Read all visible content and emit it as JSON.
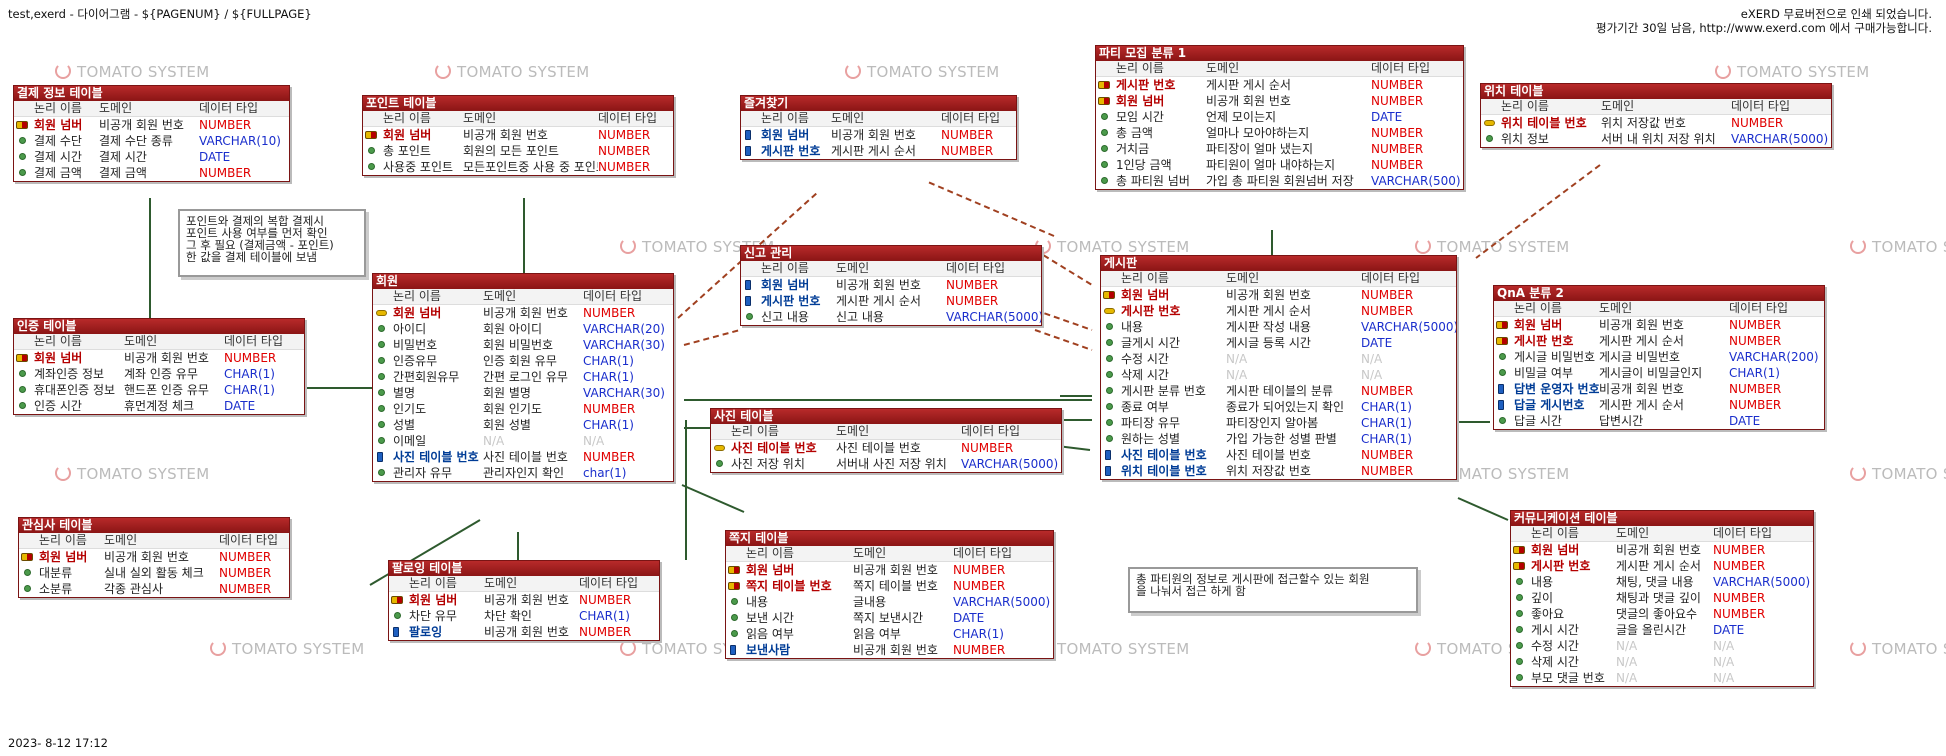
{
  "header": {
    "left": "test,exerd - 다이어그램 - ${PAGENUM} / ${FULLPAGE}",
    "right_line1": "eXERD 무료버전으로 인쇄 되었습니다.",
    "right_line2": "평가기간 30일 남음, http://www.exerd.com 에서 구매가능합니다."
  },
  "footer": {
    "date": "2023- 8-12 17:12"
  },
  "watermark": "TOMATO SYSTEM",
  "watermark_clipped": "TOMATO SYSTE",
  "colors": {
    "title_bg": "#9a1a1a",
    "number_type": "#e00000",
    "text_type": "#1a2ecc",
    "na": "#c8c8c8",
    "relation_line_green": "#2e5a2e",
    "relation_line_brown": "#a04020"
  },
  "col_headers": {
    "logical": "논리 이름",
    "domain": "도메인",
    "datatype": "데이터 타입"
  },
  "notes": [
    "포인트와 결제의 복합 결제시\n포인트 사용 여부를 먼저 확인\n그 후 필요 (결제금액 - 포인트)\n한 값을 결제 테이블에 보냄",
    "총 파티원의 정보로 게시판에 접근할수 있는 회원\n을 나눠서 접근 하게 함"
  ],
  "tables": [
    {
      "name": "결제 정보 테이블",
      "rows": [
        {
          "n": "회원 넘버",
          "d": "비공개 회원 번호",
          "t": "NUMBER",
          "k": "pkfk"
        },
        {
          "n": "결제 수단",
          "d": "결제 수단 종류",
          "t": "VARCHAR(10)",
          "k": ""
        },
        {
          "n": "결제 시간",
          "d": "결제 시간",
          "t": "DATE",
          "k": ""
        },
        {
          "n": "결제 금액",
          "d": "결제 금액",
          "t": "NUMBER",
          "k": ""
        }
      ]
    },
    {
      "name": "포인트 테이블",
      "rows": [
        {
          "n": "회원 넘버",
          "d": "비공개 회원 번호",
          "t": "NUMBER",
          "k": "pkfk"
        },
        {
          "n": "총 포인트",
          "d": "회원의 모든 포인트",
          "t": "NUMBER",
          "k": ""
        },
        {
          "n": "사용중 포인트",
          "d": "모든포인트중 사용 중 포인트",
          "t": "NUMBER",
          "k": ""
        }
      ]
    },
    {
      "name": "즐겨찾기",
      "rows": [
        {
          "n": "회원 넘버",
          "d": "비공개 회원 번호",
          "t": "NUMBER",
          "k": "fk"
        },
        {
          "n": "게시판 번호",
          "d": "게시판 게시 순서",
          "t": "NUMBER",
          "k": "fk"
        }
      ]
    },
    {
      "name": "파티 모집 분류 1",
      "rows": [
        {
          "n": "게시판 번호",
          "d": "게시판 게시 순서",
          "t": "NUMBER",
          "k": "pkfk"
        },
        {
          "n": "회원 넘버",
          "d": "비공개 회원 번호",
          "t": "NUMBER",
          "k": "pkfk"
        },
        {
          "n": "모임 시간",
          "d": "언제 모이는지",
          "t": "DATE",
          "k": ""
        },
        {
          "n": "총 금액",
          "d": "얼마나 모아야하는지",
          "t": "NUMBER",
          "k": ""
        },
        {
          "n": "거치금",
          "d": "파티장이 얼마 냈는지",
          "t": "NUMBER",
          "k": ""
        },
        {
          "n": "1인당 금액",
          "d": "파티원이 얼마 내야하는지",
          "t": "NUMBER",
          "k": ""
        },
        {
          "n": "총 파티원 넘버",
          "d": "가입 총 파티원 회원넘버 저장",
          "t": "VARCHAR(500)",
          "k": ""
        }
      ]
    },
    {
      "name": "위치 테이블",
      "rows": [
        {
          "n": "위치 테이블 번호",
          "d": "위치 저장값 번호",
          "t": "NUMBER",
          "k": "pk"
        },
        {
          "n": "위치 정보",
          "d": "서버 내 위치 저장 위치",
          "t": "VARCHAR(5000)",
          "k": ""
        }
      ]
    },
    {
      "name": "인증 테이블",
      "rows": [
        {
          "n": "회원 넘버",
          "d": "비공개 회원 번호",
          "t": "NUMBER",
          "k": "pkfk"
        },
        {
          "n": "계좌인증 정보",
          "d": "계좌 인증 유무",
          "t": "CHAR(1)",
          "k": ""
        },
        {
          "n": "휴대폰인증 정보",
          "d": "핸드폰 인증 유무",
          "t": "CHAR(1)",
          "k": ""
        },
        {
          "n": "인증 시간",
          "d": "휴먼계정 체크",
          "t": "DATE",
          "k": ""
        }
      ]
    },
    {
      "name": "회원",
      "rows": [
        {
          "n": "회원 넘버",
          "d": "비공개 회원 번호",
          "t": "NUMBER",
          "k": "pk"
        },
        {
          "n": "아이디",
          "d": "회원 아이디",
          "t": "VARCHAR(20)",
          "k": ""
        },
        {
          "n": "비밀번호",
          "d": "회원 비밀번호",
          "t": "VARCHAR(30)",
          "k": ""
        },
        {
          "n": "인증유무",
          "d": "인증 회원 유무",
          "t": "CHAR(1)",
          "k": ""
        },
        {
          "n": "간편회원유무",
          "d": "간편 로그인 유무",
          "t": "CHAR(1)",
          "k": ""
        },
        {
          "n": "별명",
          "d": "회원 별명",
          "t": "VARCHAR(30)",
          "k": ""
        },
        {
          "n": "인기도",
          "d": "회원 인기도",
          "t": "NUMBER",
          "k": ""
        },
        {
          "n": "성별",
          "d": "회원 성별",
          "t": "CHAR(1)",
          "k": ""
        },
        {
          "n": "이메일",
          "d": "N/A",
          "t": "N/A",
          "k": ""
        },
        {
          "n": "사진 테이블 번호",
          "d": "사진 테이블 번호",
          "t": "NUMBER",
          "k": "fk"
        },
        {
          "n": "관리자 유무",
          "d": "관리자인지 확인",
          "t": "char(1)",
          "k": ""
        }
      ]
    },
    {
      "name": "신고 관리",
      "rows": [
        {
          "n": "회원 넘버",
          "d": "비공개 회원 번호",
          "t": "NUMBER",
          "k": "fk"
        },
        {
          "n": "게시판 번호",
          "d": "게시판 게시 순서",
          "t": "NUMBER",
          "k": "fk"
        },
        {
          "n": "신고 내용",
          "d": "신고 내용",
          "t": "VARCHAR(5000)",
          "k": ""
        }
      ]
    },
    {
      "name": "게시판",
      "rows": [
        {
          "n": "회원 넘버",
          "d": "비공개 회원 번호",
          "t": "NUMBER",
          "k": "pkfk"
        },
        {
          "n": "게시판 번호",
          "d": "게시판 게시 순서",
          "t": "NUMBER",
          "k": "pk"
        },
        {
          "n": "내용",
          "d": "게시판 작성 내용",
          "t": "VARCHAR(5000)",
          "k": ""
        },
        {
          "n": "글게시 시간",
          "d": "게시글 등록 시간",
          "t": "DATE",
          "k": ""
        },
        {
          "n": "수정 시간",
          "d": "N/A",
          "t": "N/A",
          "k": ""
        },
        {
          "n": "삭제 시간",
          "d": "N/A",
          "t": "N/A",
          "k": ""
        },
        {
          "n": "게시판 분류 번호",
          "d": "게시판 테이블의 분류",
          "t": "NUMBER",
          "k": ""
        },
        {
          "n": "종료 여부",
          "d": "종료가 되어있는지 확인",
          "t": "CHAR(1)",
          "k": ""
        },
        {
          "n": "파티장 유무",
          "d": "파티장인지 알아봄",
          "t": "CHAR(1)",
          "k": ""
        },
        {
          "n": "원하는 성별",
          "d": "가입 가능한 성별 판별",
          "t": "CHAR(1)",
          "k": ""
        },
        {
          "n": "사진 테이블 번호",
          "d": "사진 테이블 번호",
          "t": "NUMBER",
          "k": "fk"
        },
        {
          "n": "위치 테이블 번호",
          "d": "위치 저장값 번호",
          "t": "NUMBER",
          "k": "fk"
        }
      ]
    },
    {
      "name": "QnA 분류 2",
      "rows": [
        {
          "n": "회원 넘버",
          "d": "비공개 회원 번호",
          "t": "NUMBER",
          "k": "pkfk"
        },
        {
          "n": "게시판 번호",
          "d": "게시판 게시 순서",
          "t": "NUMBER",
          "k": "pkfk"
        },
        {
          "n": "게시글 비밀번호",
          "d": "게시글 비밀번호",
          "t": "VARCHAR(200)",
          "k": ""
        },
        {
          "n": "비밀글 여부",
          "d": "게시글이 비밀글인지",
          "t": "CHAR(1)",
          "k": ""
        },
        {
          "n": "답변 운영자 번호",
          "d": "비공개 회원 번호",
          "t": "NUMBER",
          "k": "fk"
        },
        {
          "n": "답글 게시번호",
          "d": "게시판 게시 순서",
          "t": "NUMBER",
          "k": "fk"
        },
        {
          "n": "답글 시간",
          "d": "답변시간",
          "t": "DATE",
          "k": ""
        }
      ]
    },
    {
      "name": "사진 테이블",
      "rows": [
        {
          "n": "사진 테이블 번호",
          "d": "사진 테이블 번호",
          "t": "NUMBER",
          "k": "pk"
        },
        {
          "n": "사진 저장 위치",
          "d": "서버내 사진 저장 위치",
          "t": "VARCHAR(5000)",
          "k": ""
        }
      ]
    },
    {
      "name": "관심사 테이블",
      "rows": [
        {
          "n": "회원 넘버",
          "d": "비공개 회원 번호",
          "t": "NUMBER",
          "k": "pkfk"
        },
        {
          "n": "대분류",
          "d": "실내 실외 활동 체크",
          "t": "NUMBER",
          "k": ""
        },
        {
          "n": "소분류",
          "d": "각종 관심사",
          "t": "NUMBER",
          "k": ""
        }
      ]
    },
    {
      "name": "팔로잉 테이블",
      "rows": [
        {
          "n": "회원 넘버",
          "d": "비공개 회원 번호",
          "t": "NUMBER",
          "k": "pkfk"
        },
        {
          "n": "차단 유무",
          "d": "차단 확인",
          "t": "CHAR(1)",
          "k": ""
        },
        {
          "n": "팔로잉",
          "d": "비공개 회원 번호",
          "t": "NUMBER",
          "k": "fk"
        }
      ]
    },
    {
      "name": "쪽지 테이블",
      "rows": [
        {
          "n": "회원 넘버",
          "d": "비공개 회원 번호",
          "t": "NUMBER",
          "k": "pkfk"
        },
        {
          "n": "쪽지 테이블 번호",
          "d": "쪽지 테이블 번호",
          "t": "NUMBER",
          "k": "pkfk"
        },
        {
          "n": "내용",
          "d": "글내용",
          "t": "VARCHAR(5000)",
          "k": ""
        },
        {
          "n": "보낸 시간",
          "d": "쪽지 보낸시간",
          "t": "DATE",
          "k": ""
        },
        {
          "n": "읽음 여부",
          "d": "읽음 여부",
          "t": "CHAR(1)",
          "k": ""
        },
        {
          "n": "보낸사람",
          "d": "비공개 회원 번호",
          "t": "NUMBER",
          "k": "fk"
        }
      ]
    },
    {
      "name": "커뮤니케이션 테이블",
      "rows": [
        {
          "n": "회원 넘버",
          "d": "비공개 회원 번호",
          "t": "NUMBER",
          "k": "pkfk"
        },
        {
          "n": "게시판 번호",
          "d": "게시판 게시 순서",
          "t": "NUMBER",
          "k": "pkfk"
        },
        {
          "n": "내용",
          "d": "채팅, 댓글 내용",
          "t": "VARCHAR(5000)",
          "k": ""
        },
        {
          "n": "깊이",
          "d": "채팅과 댓글 깊이",
          "t": "NUMBER",
          "k": ""
        },
        {
          "n": "좋아요",
          "d": "댓글의 좋아요수",
          "t": "NUMBER",
          "k": ""
        },
        {
          "n": "게시 시간",
          "d": "글을 올린시간",
          "t": "DATE",
          "k": ""
        },
        {
          "n": "수정 시간",
          "d": "N/A",
          "t": "N/A",
          "k": ""
        },
        {
          "n": "삭제 시간",
          "d": "N/A",
          "t": "N/A",
          "k": ""
        },
        {
          "n": "부모 댓글 번호",
          "d": "N/A",
          "t": "N/A",
          "k": ""
        }
      ]
    }
  ]
}
